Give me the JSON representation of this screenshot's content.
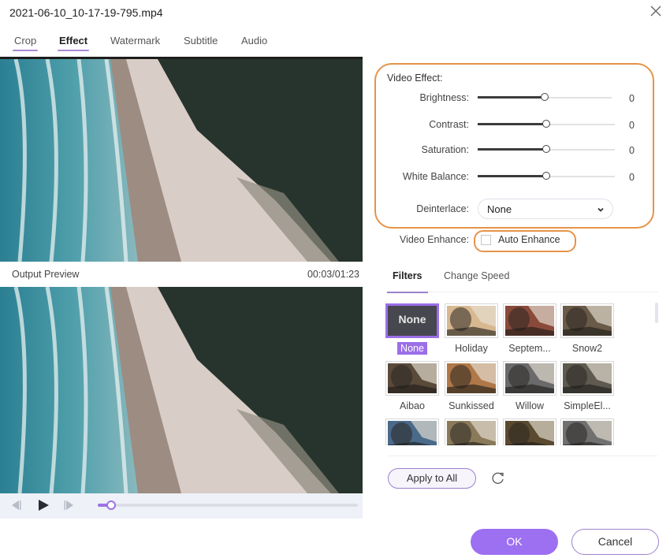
{
  "window": {
    "title": "2021-06-10_10-17-19-795.mp4",
    "close_icon": "close-icon"
  },
  "tabs": [
    {
      "label": "Crop",
      "active": false,
      "underlined": true
    },
    {
      "label": "Effect",
      "active": true,
      "underlined": true
    },
    {
      "label": "Watermark",
      "active": false,
      "underlined": false
    },
    {
      "label": "Subtitle",
      "active": false,
      "underlined": false
    },
    {
      "label": "Audio",
      "active": false,
      "underlined": false
    }
  ],
  "preview": {
    "output_label": "Output Preview",
    "time": "00:03/01:23",
    "progress_fraction": 0.05
  },
  "player": {
    "prev_icon": "previous-frame-icon",
    "play_icon": "play-icon",
    "next_icon": "next-frame-icon"
  },
  "video_effect": {
    "heading": "Video Effect:",
    "sliders": [
      {
        "label": "Brightness:",
        "value": "0",
        "position_fraction": 0.5
      },
      {
        "label": "Contrast:",
        "value": "0",
        "position_fraction": 0.5
      },
      {
        "label": "Saturation:",
        "value": "0",
        "position_fraction": 0.5
      },
      {
        "label": "White Balance:",
        "value": "0",
        "position_fraction": 0.5
      }
    ],
    "deinterlace": {
      "label": "Deinterlace:",
      "value": "None"
    }
  },
  "video_enhance": {
    "label": "Video Enhance:",
    "checkbox_label": "Auto Enhance",
    "checked": false
  },
  "subtabs": [
    {
      "label": "Filters",
      "active": true
    },
    {
      "label": "Change Speed",
      "active": false
    }
  ],
  "filters": [
    {
      "label": "None",
      "selected": true,
      "thumb_text": "None"
    },
    {
      "label": "Holiday",
      "selected": false,
      "tint": "#d8b890"
    },
    {
      "label": "Septem...",
      "selected": false,
      "tint": "#8a4a3a"
    },
    {
      "label": "Snow2",
      "selected": false,
      "tint": "#6a5a48"
    },
    {
      "label": "Aibao",
      "selected": false,
      "tint": "#5a4a3a"
    },
    {
      "label": "Sunkissed",
      "selected": false,
      "tint": "#b07848"
    },
    {
      "label": "Willow",
      "selected": false,
      "tint": "#6a6a6a"
    },
    {
      "label": "SimpleEl...",
      "selected": false,
      "tint": "#5e5a50"
    },
    {
      "label": "",
      "selected": false,
      "tint": "#4a6a8a"
    },
    {
      "label": "",
      "selected": false,
      "tint": "#8a7a5a"
    },
    {
      "label": "",
      "selected": false,
      "tint": "#5a4a30"
    },
    {
      "label": "",
      "selected": false,
      "tint": "#707070"
    }
  ],
  "actions": {
    "apply_all": "Apply to All",
    "reset_icon": "reset-icon",
    "ok": "OK",
    "cancel": "Cancel"
  },
  "colors": {
    "accent": "#9d6ff1",
    "highlight_box": "#e5944a"
  }
}
